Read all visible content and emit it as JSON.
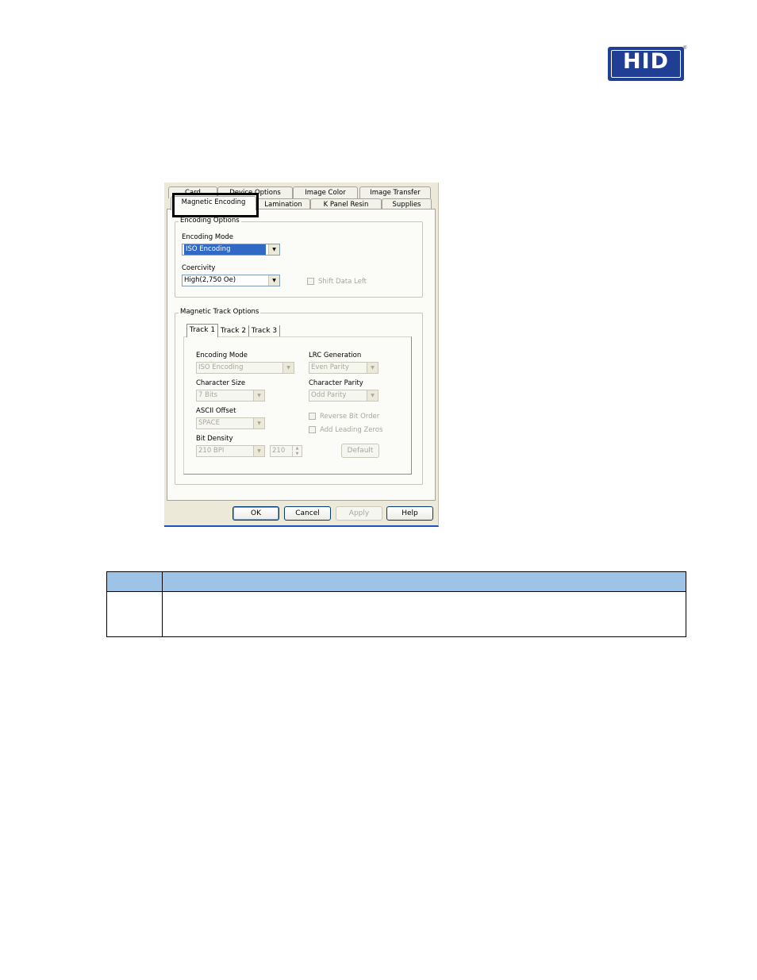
{
  "logo": {
    "text": "HID",
    "reg": "®"
  },
  "dialog": {
    "tabs_back": [
      "Card",
      "Device Options",
      "Image Color",
      "Image Transfer"
    ],
    "tabs_front": [
      "Magnetic Encoding",
      "Lamination",
      "K Panel Resin",
      "Supplies"
    ],
    "encoding_options": {
      "title": "Encoding Options",
      "mode_label": "Encoding Mode",
      "mode_value": "ISO Encoding",
      "coercivity_label": "Coercivity",
      "coercivity_value": "High(2,750 Oe)",
      "shift_label": "Shift Data Left"
    },
    "track_options": {
      "title": "Magnetic Track Options",
      "tabs": [
        "Track 1",
        "Track 2",
        "Track 3"
      ],
      "encoding_mode_label": "Encoding Mode",
      "encoding_mode_value": "ISO Encoding",
      "char_size_label": "Character Size",
      "char_size_value": "7 Bits",
      "ascii_label": "ASCII Offset",
      "ascii_value": "SPACE",
      "bit_density_label": "Bit Density",
      "bit_density_value": "210 BPI",
      "bit_density_spin": "210",
      "lrc_label": "LRC Generation",
      "lrc_value": "Even Parity",
      "parity_label": "Character Parity",
      "parity_value": "Odd Parity",
      "reverse_label": "Reverse Bit Order",
      "leading_label": "Add Leading Zeros",
      "default_label": "Default"
    },
    "buttons": {
      "ok": "OK",
      "cancel": "Cancel",
      "apply": "Apply",
      "help": "Help"
    }
  },
  "table": {
    "col1_header": "",
    "col2_header": "",
    "row1_col1": "",
    "row1_col2": ""
  }
}
